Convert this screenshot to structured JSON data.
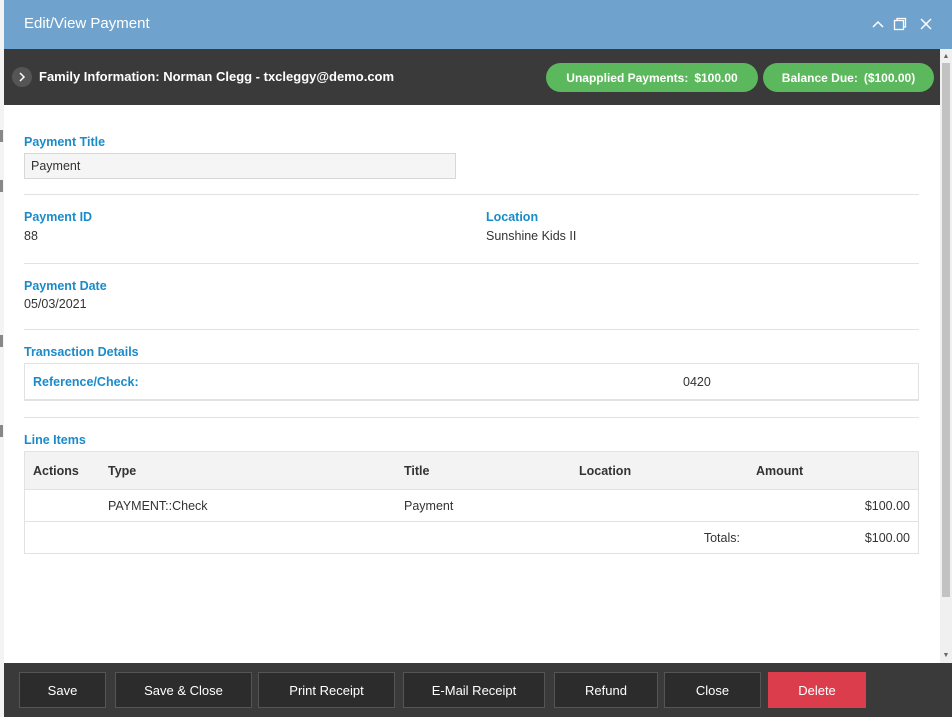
{
  "window": {
    "title": "Edit/View Payment"
  },
  "family": {
    "label": "Family Information: Norman Clegg - txcleggy@demo.com",
    "unapplied_label": "Unapplied Payments:",
    "unapplied_value": "$100.00",
    "balance_label": "Balance Due:",
    "balance_value": "($100.00)",
    "pill_color": "#5cb85c"
  },
  "form": {
    "payment_title_label": "Payment Title",
    "payment_title_value": "Payment",
    "payment_id_label": "Payment ID",
    "payment_id_value": "88",
    "location_label": "Location",
    "location_value": "Sunshine Kids II",
    "payment_date_label": "Payment Date",
    "payment_date_value": "05/03/2021",
    "transaction_details_label": "Transaction Details",
    "reference_label": "Reference/Check:",
    "reference_value": "0420"
  },
  "line_items": {
    "section_label": "Line Items",
    "columns": [
      "Actions",
      "Type",
      "Title",
      "Location",
      "Amount"
    ],
    "rows": [
      {
        "actions": "",
        "type": "PAYMENT::Check",
        "title": "Payment",
        "location": "",
        "amount": "$100.00"
      }
    ],
    "totals_label": "Totals:",
    "totals_value": "$100.00"
  },
  "footer": {
    "save": "Save",
    "save_close": "Save & Close",
    "print_receipt": "Print Receipt",
    "email_receipt": "E-Mail Receipt",
    "refund": "Refund",
    "close": "Close",
    "delete": "Delete",
    "delete_color": "#dc3d4c"
  },
  "icons": {
    "minimize": "chevron-up-icon",
    "maximize": "restore-icon",
    "close": "close-icon",
    "expand": "chevron-right-icon"
  },
  "colors": {
    "titlebar": "#6fa3cd",
    "label_blue": "#1a8bc9",
    "dark_bar": "#3a3a3a"
  }
}
